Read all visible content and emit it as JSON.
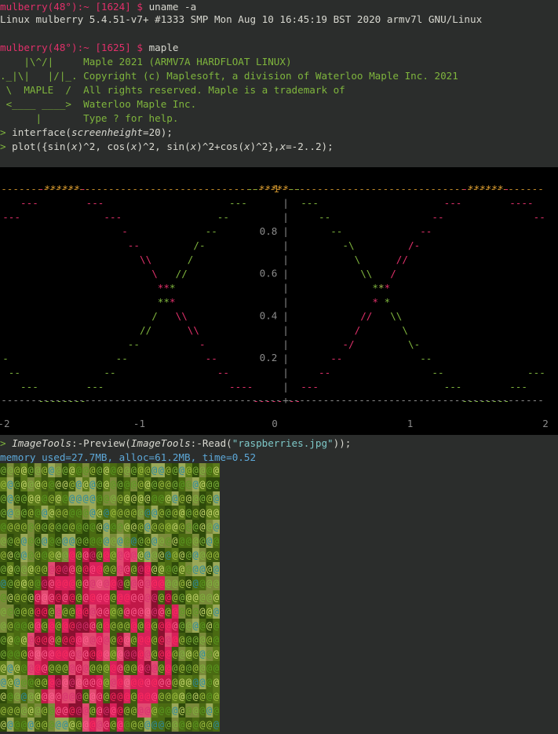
{
  "terminal": {
    "prompt1": {
      "host": "mulberry(48°):~ [1624] $",
      "cmd": " uname -a"
    },
    "uname_output": "Linux mulberry 5.4.51-v7+ #1333 SMP Mon Aug 10 16:45:19 BST 2020 armv7l GNU/Linux",
    "prompt2": {
      "host": "mulberry(48°):~ [1625] $",
      "cmd": " maple"
    },
    "banner": {
      "logo": [
        "    |\\^/|     ",
        "._|\\|   |/|_. ",
        " \\  MAPLE  /  ",
        " <____ ____>  ",
        "      |       "
      ],
      "text": [
        "Maple 2021 (ARMV7A HARDFLOAT LINUX)",
        "Copyright (c) Maplesoft, a division of Waterloo Maple Inc. 2021",
        "All rights reserved. Maple is a trademark of",
        "Waterloo Maple Inc.",
        "Type ? for help."
      ]
    },
    "cmd_interface": {
      "prompt": "> ",
      "fn": "interface(",
      "arg": "screenheight",
      "rest": "=20);"
    },
    "cmd_plot": {
      "prompt": "> ",
      "pre": "plot({sin(",
      "x1": "x",
      "a": ")^2, cos(",
      "x2": "x",
      "b": ")^2, sin(",
      "x3": "x",
      "c": ")^2+cos(",
      "x4": "x",
      "d": ")^2},",
      "x5": "x",
      "e": "=-2..2);"
    },
    "cmd_image": {
      "prompt": "> ",
      "t1": "ImageTools",
      "t2": ":-Preview(",
      "t3": "ImageTools",
      "t4": ":-Read(",
      "t5": "\"raspberries.jpg\"",
      "t6": "));"
    },
    "memory": "memory used=27.7MB, alloc=61.2MB, time=0.52"
  },
  "chart_data": {
    "type": "line",
    "render": "ascii",
    "xlim": [
      -2,
      2
    ],
    "ylim": [
      0,
      1
    ],
    "xticks": [
      "-2",
      "-1",
      "0",
      "1",
      "2"
    ],
    "yticks": [
      "0.2",
      "0.4",
      "0.6",
      "0.8"
    ],
    "top_label": "1",
    "series": [
      {
        "expr": "sin(x)^2",
        "color": "#e0306a",
        "x": [
          -2,
          -1.5,
          -1,
          -0.5,
          0,
          0.5,
          1,
          1.5,
          2
        ],
        "y": [
          0.83,
          0.99,
          0.71,
          0.23,
          0,
          0.23,
          0.71,
          0.99,
          0.83
        ]
      },
      {
        "expr": "cos(x)^2",
        "color": "#7fb53d",
        "x": [
          -2,
          -1.5,
          -1,
          -0.5,
          0,
          0.5,
          1,
          1.5,
          2
        ],
        "y": [
          0.17,
          0.01,
          0.29,
          0.77,
          1,
          0.77,
          0.29,
          0.01,
          0.17
        ]
      },
      {
        "expr": "sin(x)^2+cos(x)^2",
        "color": "#e0a030",
        "x": [
          -2,
          2
        ],
        "y": [
          1,
          1
        ]
      }
    ]
  },
  "colors": {
    "prompt": "#e0306a",
    "green": "#7fb53d",
    "plot_bg": "#000000",
    "memory": "#5da8d8",
    "axis_text": "#8a8a8a",
    "one_line": "#e0a030"
  },
  "image_preview": {
    "description_glyph": "@",
    "filename": "raspberries.jpg"
  }
}
